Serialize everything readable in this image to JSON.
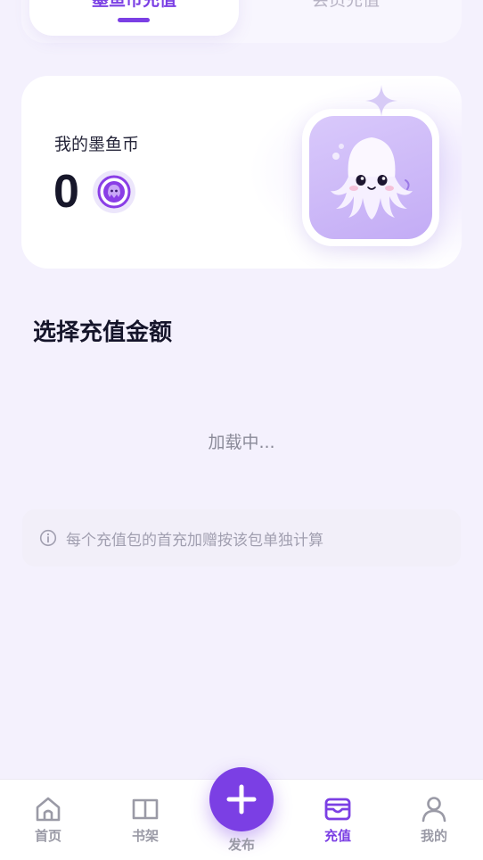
{
  "tabs": {
    "active_label": "墨鱼币充值",
    "other_label": "会员充值"
  },
  "balance": {
    "label": "我的墨鱼币",
    "amount": "0",
    "coin_icon": "squid-coin-icon",
    "mascot": "squid-mascot-image"
  },
  "section": {
    "title": "选择充值金额",
    "loading_text": "加载中..."
  },
  "note": {
    "icon": "info-icon",
    "text": "每个充值包的首充加赠按该包单独计算"
  },
  "nav": {
    "items": [
      {
        "label": "首页",
        "icon": "home-icon"
      },
      {
        "label": "书架",
        "icon": "book-icon"
      },
      {
        "label": "发布",
        "icon": "plus-icon"
      },
      {
        "label": "充值",
        "icon": "wallet-icon"
      },
      {
        "label": "我的",
        "icon": "user-icon"
      }
    ],
    "active": "充值"
  },
  "colors": {
    "accent": "#7b3fe4",
    "background": "#f4f1fd",
    "inactive": "#9a9aa6"
  }
}
